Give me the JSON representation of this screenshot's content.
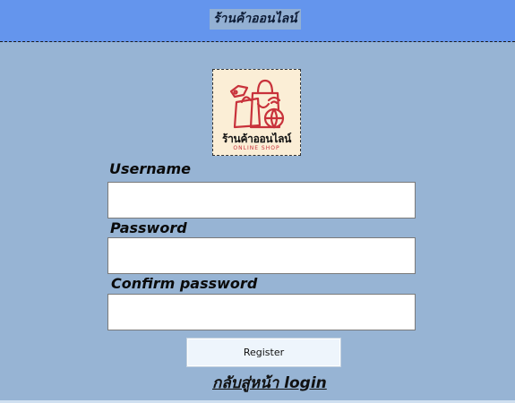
{
  "header": {
    "title": "ร้านค้าออนไลน์"
  },
  "logo": {
    "name": "ร้านค้าออนไลน์",
    "subtitle": "ONLINE SHOP",
    "icon": "shopping-bags-globe-icon"
  },
  "form": {
    "username_label": "Username",
    "username_value": "",
    "password_label": "Password",
    "password_value": "",
    "confirm_label": "Confirm password",
    "confirm_value": "",
    "register_label": "Register",
    "back_link_label": "กลับสู่หน้า login"
  },
  "colors": {
    "header_bg": "#6495ed",
    "body_bg": "#97b4d4",
    "logo_bg": "#fbeed6",
    "logo_accent": "#c8323b",
    "button_bg": "#eef5fc"
  }
}
